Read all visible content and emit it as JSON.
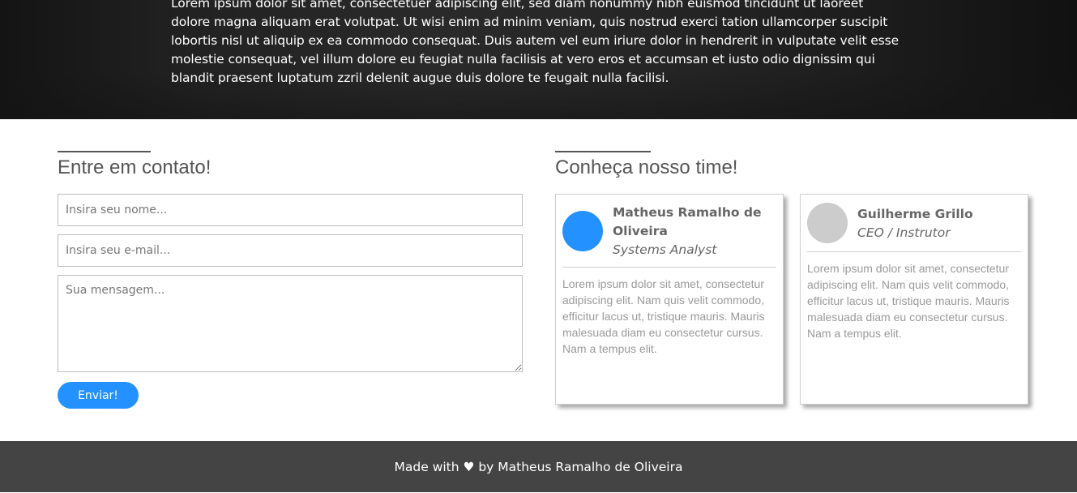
{
  "hero": {
    "text": "Lorem ipsum dolor sit amet, consectetuer adipiscing elit, sed diam nonummy nibh euismod tincidunt ut laoreet dolore magna aliquam erat volutpat. Ut wisi enim ad minim veniam, quis nostrud exerci tation ullamcorper suscipit lobortis nisl ut aliquip ex ea commodo consequat. Duis autem vel eum iriure dolor in hendrerit in vulputate velit esse molestie consequat, vel illum dolore eu feugiat nulla facilisis at vero eros et accumsan et iusto odio dignissim qui blandit praesent luptatum zzril delenit augue duis dolore te feugait nulla facilisi."
  },
  "contact": {
    "title": "Entre em contato!",
    "name_placeholder": "Insira seu nome...",
    "email_placeholder": "Insira seu e-mail...",
    "message_placeholder": "Sua mensagem...",
    "send_label": "Enviar!"
  },
  "team": {
    "title": "Conheça nosso time!",
    "members": [
      {
        "name": "Matheus Ramalho de Oliveira",
        "role": "Systems Analyst",
        "avatar_color": "#2391ff",
        "bio": "Lorem ipsum dolor sit amet, consectetur adipiscing elit. Nam quis velit commodo, efficitur lacus ut, tristique mauris. Mauris malesuada diam eu consectetur cursus. Nam a tempus elit."
      },
      {
        "name": "Guilherme Grillo",
        "role": "CEO / Instrutor",
        "avatar_color": "#cccccc",
        "bio": "Lorem ipsum dolor sit amet, consectetur adipiscing elit. Nam quis velit commodo, efficitur lacus ut, tristique mauris. Mauris malesuada diam eu consectetur cursus. Nam a tempus elit."
      }
    ]
  },
  "footer": {
    "text": "Made with ♥ by Matheus Ramalho de Oliveira"
  },
  "colors": {
    "accent": "#2391ff",
    "footer_bg": "#444444"
  }
}
